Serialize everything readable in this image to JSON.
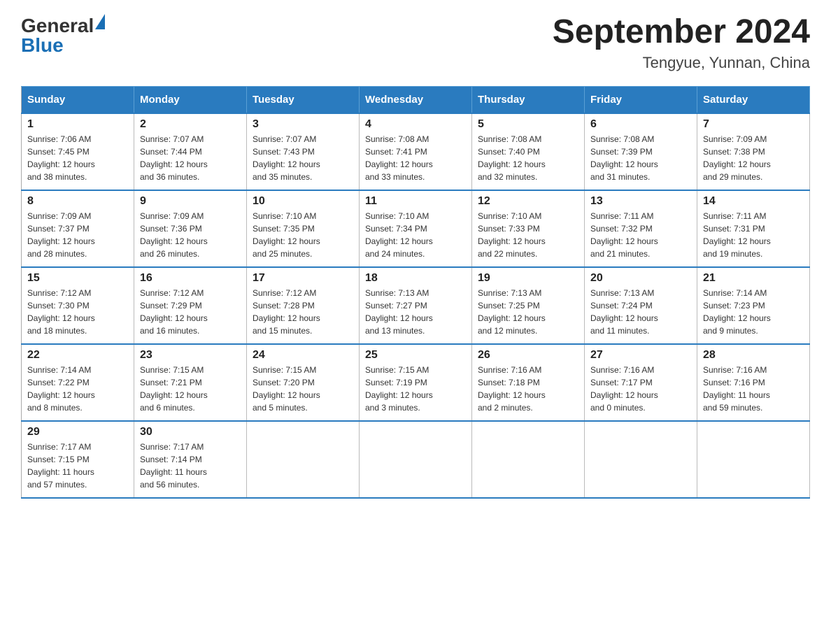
{
  "header": {
    "logo_general": "General",
    "logo_blue": "Blue",
    "title": "September 2024",
    "subtitle": "Tengyue, Yunnan, China"
  },
  "calendar": {
    "days": [
      "Sunday",
      "Monday",
      "Tuesday",
      "Wednesday",
      "Thursday",
      "Friday",
      "Saturday"
    ],
    "weeks": [
      [
        {
          "num": "1",
          "sunrise": "7:06 AM",
          "sunset": "7:45 PM",
          "daylight": "12 hours and 38 minutes."
        },
        {
          "num": "2",
          "sunrise": "7:07 AM",
          "sunset": "7:44 PM",
          "daylight": "12 hours and 36 minutes."
        },
        {
          "num": "3",
          "sunrise": "7:07 AM",
          "sunset": "7:43 PM",
          "daylight": "12 hours and 35 minutes."
        },
        {
          "num": "4",
          "sunrise": "7:08 AM",
          "sunset": "7:41 PM",
          "daylight": "12 hours and 33 minutes."
        },
        {
          "num": "5",
          "sunrise": "7:08 AM",
          "sunset": "7:40 PM",
          "daylight": "12 hours and 32 minutes."
        },
        {
          "num": "6",
          "sunrise": "7:08 AM",
          "sunset": "7:39 PM",
          "daylight": "12 hours and 31 minutes."
        },
        {
          "num": "7",
          "sunrise": "7:09 AM",
          "sunset": "7:38 PM",
          "daylight": "12 hours and 29 minutes."
        }
      ],
      [
        {
          "num": "8",
          "sunrise": "7:09 AM",
          "sunset": "7:37 PM",
          "daylight": "12 hours and 28 minutes."
        },
        {
          "num": "9",
          "sunrise": "7:09 AM",
          "sunset": "7:36 PM",
          "daylight": "12 hours and 26 minutes."
        },
        {
          "num": "10",
          "sunrise": "7:10 AM",
          "sunset": "7:35 PM",
          "daylight": "12 hours and 25 minutes."
        },
        {
          "num": "11",
          "sunrise": "7:10 AM",
          "sunset": "7:34 PM",
          "daylight": "12 hours and 24 minutes."
        },
        {
          "num": "12",
          "sunrise": "7:10 AM",
          "sunset": "7:33 PM",
          "daylight": "12 hours and 22 minutes."
        },
        {
          "num": "13",
          "sunrise": "7:11 AM",
          "sunset": "7:32 PM",
          "daylight": "12 hours and 21 minutes."
        },
        {
          "num": "14",
          "sunrise": "7:11 AM",
          "sunset": "7:31 PM",
          "daylight": "12 hours and 19 minutes."
        }
      ],
      [
        {
          "num": "15",
          "sunrise": "7:12 AM",
          "sunset": "7:30 PM",
          "daylight": "12 hours and 18 minutes."
        },
        {
          "num": "16",
          "sunrise": "7:12 AM",
          "sunset": "7:29 PM",
          "daylight": "12 hours and 16 minutes."
        },
        {
          "num": "17",
          "sunrise": "7:12 AM",
          "sunset": "7:28 PM",
          "daylight": "12 hours and 15 minutes."
        },
        {
          "num": "18",
          "sunrise": "7:13 AM",
          "sunset": "7:27 PM",
          "daylight": "12 hours and 13 minutes."
        },
        {
          "num": "19",
          "sunrise": "7:13 AM",
          "sunset": "7:25 PM",
          "daylight": "12 hours and 12 minutes."
        },
        {
          "num": "20",
          "sunrise": "7:13 AM",
          "sunset": "7:24 PM",
          "daylight": "12 hours and 11 minutes."
        },
        {
          "num": "21",
          "sunrise": "7:14 AM",
          "sunset": "7:23 PM",
          "daylight": "12 hours and 9 minutes."
        }
      ],
      [
        {
          "num": "22",
          "sunrise": "7:14 AM",
          "sunset": "7:22 PM",
          "daylight": "12 hours and 8 minutes."
        },
        {
          "num": "23",
          "sunrise": "7:15 AM",
          "sunset": "7:21 PM",
          "daylight": "12 hours and 6 minutes."
        },
        {
          "num": "24",
          "sunrise": "7:15 AM",
          "sunset": "7:20 PM",
          "daylight": "12 hours and 5 minutes."
        },
        {
          "num": "25",
          "sunrise": "7:15 AM",
          "sunset": "7:19 PM",
          "daylight": "12 hours and 3 minutes."
        },
        {
          "num": "26",
          "sunrise": "7:16 AM",
          "sunset": "7:18 PM",
          "daylight": "12 hours and 2 minutes."
        },
        {
          "num": "27",
          "sunrise": "7:16 AM",
          "sunset": "7:17 PM",
          "daylight": "12 hours and 0 minutes."
        },
        {
          "num": "28",
          "sunrise": "7:16 AM",
          "sunset": "7:16 PM",
          "daylight": "11 hours and 59 minutes."
        }
      ],
      [
        {
          "num": "29",
          "sunrise": "7:17 AM",
          "sunset": "7:15 PM",
          "daylight": "11 hours and 57 minutes."
        },
        {
          "num": "30",
          "sunrise": "7:17 AM",
          "sunset": "7:14 PM",
          "daylight": "11 hours and 56 minutes."
        },
        null,
        null,
        null,
        null,
        null
      ]
    ]
  }
}
